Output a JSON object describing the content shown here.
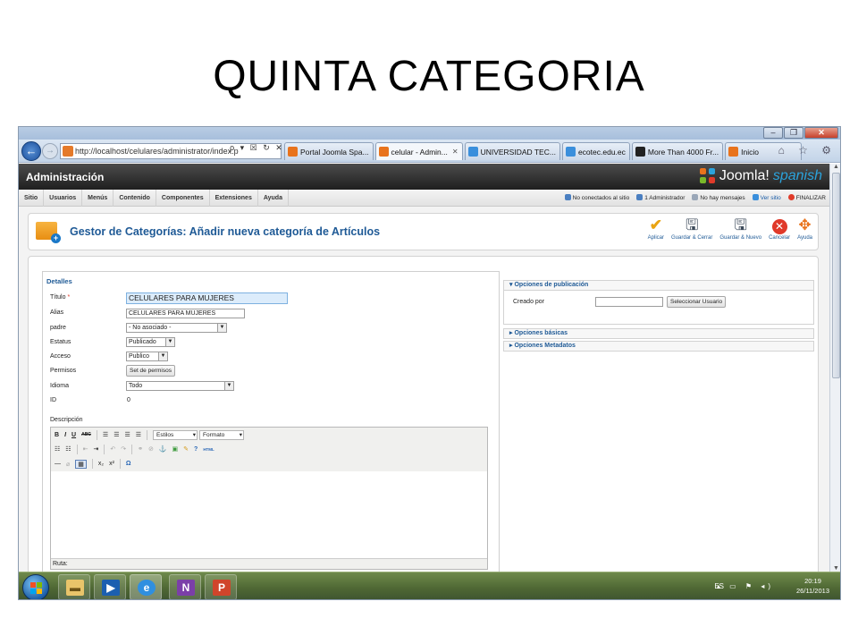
{
  "slide": {
    "title": "QUINTA CATEGORIA"
  },
  "browser": {
    "address": "http://localhost/celulares/administrator/index.p",
    "address_tools": "ρ ▾ ☒ ↻ ✕",
    "tabs": [
      {
        "label": "Portal Joomla Spa...",
        "icon_color": "#e8731c",
        "active": false
      },
      {
        "label": "celular - Admin...",
        "icon_color": "#e8731c",
        "active": true,
        "closable": true
      },
      {
        "label": "UNIVERSIDAD TEC...",
        "icon_color": "#3a8fdc",
        "active": false
      },
      {
        "label": "ecotec.edu.ec",
        "icon_color": "#3a8fdc",
        "active": false
      },
      {
        "label": "More Than 4000 Fr...",
        "icon_color": "#222222",
        "active": false
      },
      {
        "label": "Inicio",
        "icon_color": "#e8731c",
        "active": false
      }
    ],
    "nav_right_icons": "⌂ ☆ ⚙"
  },
  "admin": {
    "header_title": "Administración",
    "logo_word": "Joomla!",
    "logo_lang": "spanish",
    "menu": [
      "Sitio",
      "Usuarios",
      "Menús",
      "Contenido",
      "Componentes",
      "Extensiones",
      "Ayuda"
    ],
    "status": {
      "not_connected": "No conectados al sitio",
      "admins": "1 Administrador",
      "messages": "No hay mensajes",
      "view_site": "Ver sitio",
      "logout": "FINALIZAR"
    },
    "page_title": "Gestor de Categorías: Añadir nueva categoría de Artículos",
    "toolbar": {
      "apply": "Aplicar",
      "save_close": "Guardar & Cerrar",
      "save_new": "Guardar & Nuevo",
      "cancel": "Cancelar",
      "help": "Ayuda"
    },
    "details": {
      "legend": "Detalles",
      "title_label": "Título",
      "title_required": "*",
      "title_value": "CELULARES PARA MUJERES",
      "alias_label": "Alias",
      "alias_value": "CELULARES PARA MUJERES",
      "parent_label": "padre",
      "parent_value": "- No asociado -",
      "status_label": "Estatus",
      "status_value": "Publicado",
      "access_label": "Acceso",
      "access_value": "Publico",
      "perms_label": "Permisos",
      "perms_button": "Set de permisos",
      "lang_label": "Idioma",
      "lang_value": "Todo",
      "id_label": "ID",
      "id_value": "0",
      "desc_label": "Descripción"
    },
    "editor": {
      "styles": "Estilos",
      "format": "Formato",
      "path_label": "Ruta:",
      "html_button": "HTML"
    },
    "side": {
      "publishing": "Opciones de publicación",
      "created_by": "Creado por",
      "select_user": "Seleccionar Usuario",
      "basic": "Opciones básicas",
      "metadata": "Opciones Metadatos"
    }
  },
  "taskbar": {
    "lang": "ES",
    "tray_icons": "▴ ▭ ⚑ ◂)",
    "time": "20:19",
    "date": "26/11/2013"
  }
}
